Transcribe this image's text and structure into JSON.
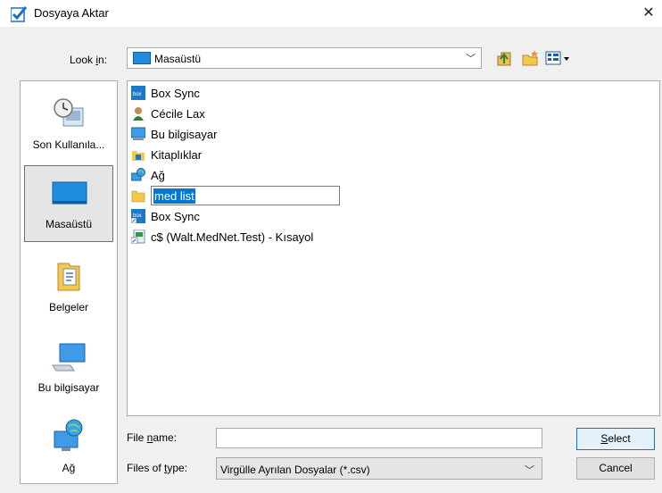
{
  "window": {
    "title": "Dosyaya Aktar",
    "close_glyph": "✕"
  },
  "lookin": {
    "label_pre": "Look ",
    "label_accel": "i",
    "label_post": "n:",
    "value": "Masaüstü"
  },
  "places": [
    {
      "label": "Son Kullanıla...",
      "icon": "recent-places-icon"
    },
    {
      "label": "Masaüstü",
      "icon": "desktop-icon",
      "selected": true
    },
    {
      "label": "Belgeler",
      "icon": "documents-icon"
    },
    {
      "label": "Bu bilgisayar",
      "icon": "this-pc-icon"
    },
    {
      "label": "Ağ",
      "icon": "network-icon"
    }
  ],
  "files": [
    {
      "label": "Box Sync",
      "icon": "box-icon"
    },
    {
      "label": "Cécile Lax",
      "icon": "user-folder-icon"
    },
    {
      "label": "Bu bilgisayar",
      "icon": "computer-icon"
    },
    {
      "label": "Kitaplıklar",
      "icon": "libraries-icon"
    },
    {
      "label": "Ağ",
      "icon": "network-icon"
    },
    {
      "label": "med list",
      "icon": "folder-icon",
      "renaming": true
    },
    {
      "label": "Box Sync",
      "icon": "box-shortcut-icon"
    },
    {
      "label": "c$ (Walt.MedNet.Test) - Kısayol",
      "icon": "shortcut-icon"
    }
  ],
  "filename": {
    "label_pre": "File ",
    "label_accel": "n",
    "label_post": "ame:",
    "value": ""
  },
  "filetype": {
    "label_pre": "Files of ",
    "label_accel": "t",
    "label_post": "ype:",
    "value": "Virgülle Ayrılan Dosyalar (*.csv)"
  },
  "buttons": {
    "select_accel": "S",
    "select_rest": "elect",
    "cancel": "Cancel"
  },
  "colors": {
    "accent": "#0078d7",
    "selection": "#0078d7"
  }
}
